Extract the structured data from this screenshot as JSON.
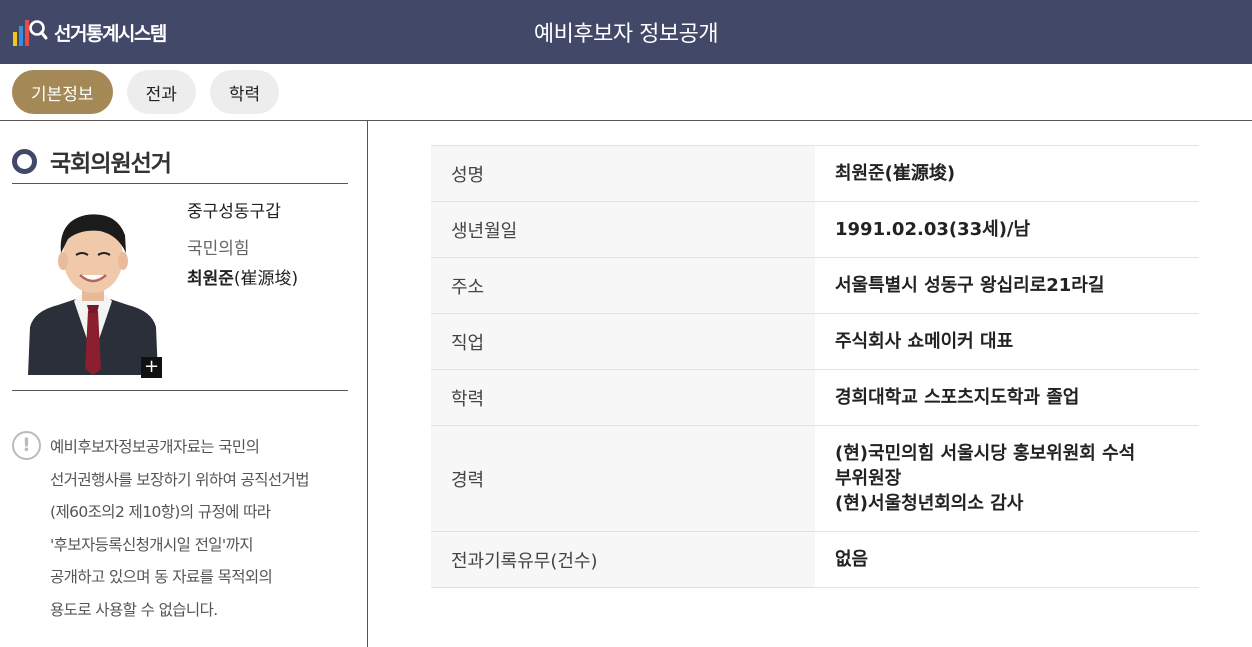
{
  "header": {
    "logo_text": "선거통계시스템",
    "title": "예비후보자 정보공개",
    "bg_color": "#414868"
  },
  "tabs": [
    {
      "label": "기본정보",
      "active": true
    },
    {
      "label": "전과",
      "active": false
    },
    {
      "label": "학력",
      "active": false
    }
  ],
  "accent_color": "#a48956",
  "election": {
    "title": "국회의원선거"
  },
  "candidate": {
    "district": "중구성동구갑",
    "party": "국민의힘",
    "name": "최원준",
    "name_hanja": "(崔源埈)",
    "zoom_icon": "plus-icon"
  },
  "notice": {
    "lines": [
      "예비후보자정보공개자료는 국민의",
      "선거권행사를 보장하기 위하여 공직선거법",
      "(제60조의2 제10항)의 규정에 따라",
      "'후보자등록신청개시일 전일'까지",
      "공개하고 있으며 동 자료를 목적외의",
      "용도로 사용할 수 없습니다."
    ]
  },
  "info": {
    "rows": [
      {
        "label": "성명",
        "value": [
          "최원준(崔源埈)"
        ]
      },
      {
        "label": "생년월일",
        "value": [
          "1991.02.03(33세)/남"
        ]
      },
      {
        "label": "주소",
        "value": [
          "서울특별시 성동구 왕십리로21라길"
        ]
      },
      {
        "label": "직업",
        "value": [
          "주식회사 쇼메이커 대표"
        ]
      },
      {
        "label": "학력",
        "value": [
          "경희대학교 스포츠지도학과 졸업"
        ]
      },
      {
        "label": "경력",
        "value": [
          "(현)국민의힘 서울시당 홍보위원회 수석",
          "부위원장",
          "(현)서울청년회의소 감사"
        ]
      },
      {
        "label": "전과기록유무(건수)",
        "value": [
          "없음"
        ]
      }
    ]
  }
}
